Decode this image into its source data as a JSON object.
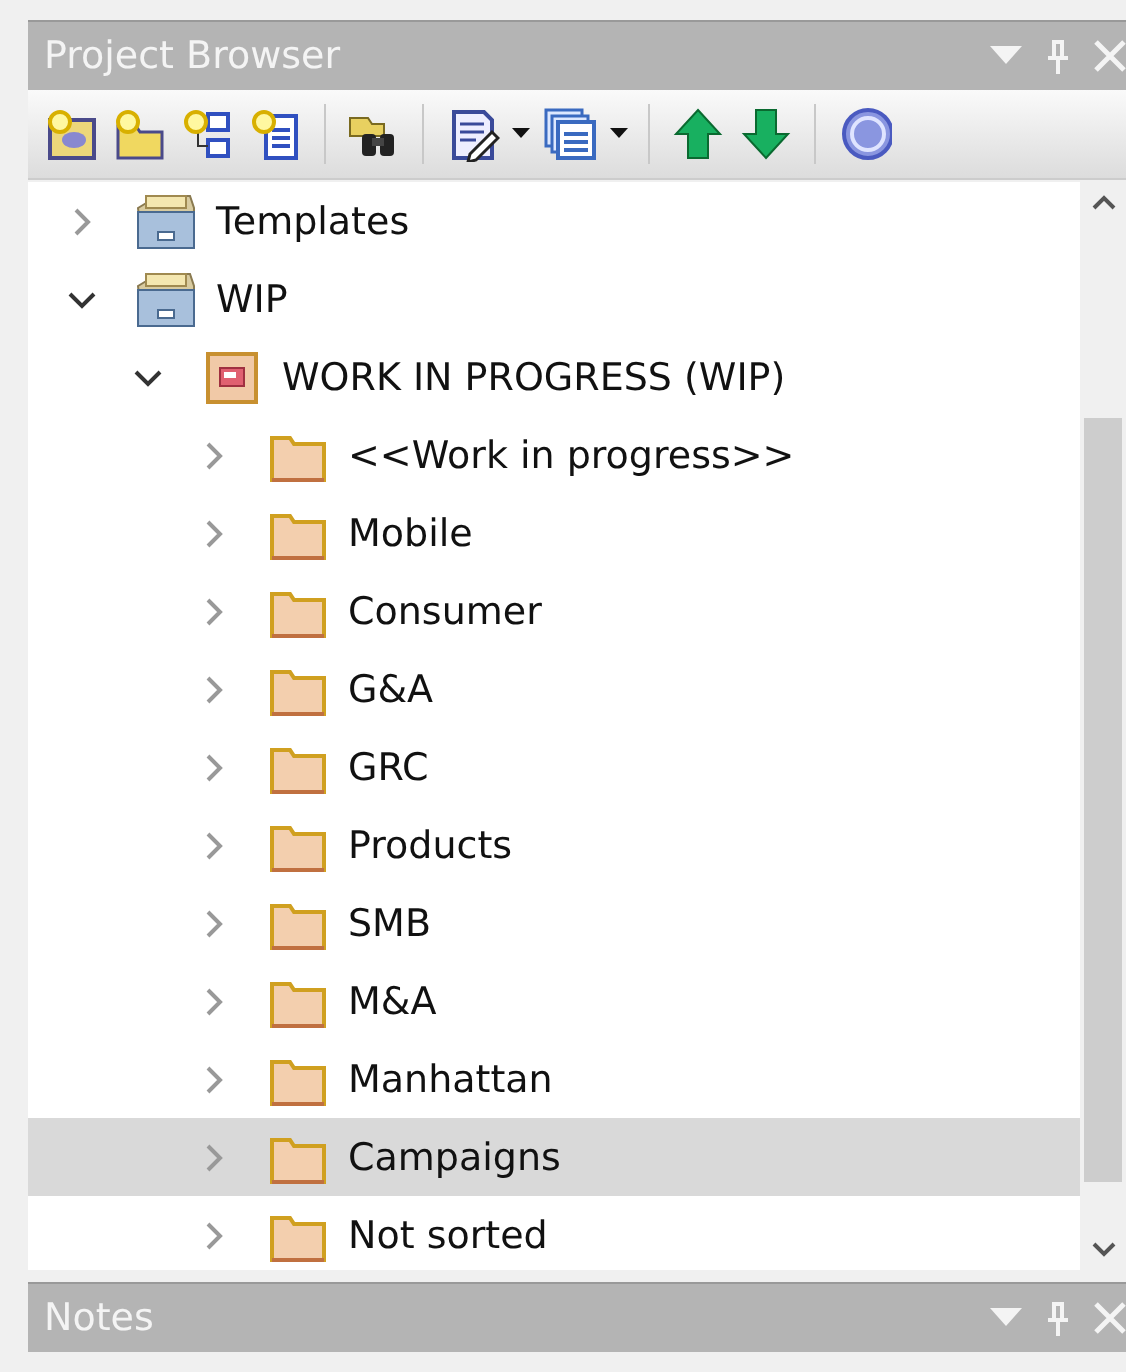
{
  "project_browser": {
    "title": "Project Browser",
    "tree": [
      {
        "label": "Templates",
        "kind": "repository",
        "expanded": false,
        "selected": false
      },
      {
        "label": "WIP",
        "kind": "repository",
        "expanded": true,
        "selected": false,
        "children": [
          {
            "label": "WORK IN PROGRESS (WIP)",
            "kind": "model",
            "expanded": true,
            "selected": false,
            "children": [
              {
                "label": "<<Work in progress>>",
                "kind": "folder",
                "expanded": false,
                "selected": false
              },
              {
                "label": "Mobile",
                "kind": "folder",
                "expanded": false,
                "selected": false
              },
              {
                "label": "Consumer",
                "kind": "folder",
                "expanded": false,
                "selected": false
              },
              {
                "label": "G&A",
                "kind": "folder",
                "expanded": false,
                "selected": false
              },
              {
                "label": "GRC",
                "kind": "folder",
                "expanded": false,
                "selected": false
              },
              {
                "label": "Products",
                "kind": "folder",
                "expanded": false,
                "selected": false
              },
              {
                "label": "SMB",
                "kind": "folder",
                "expanded": false,
                "selected": false
              },
              {
                "label": "M&A",
                "kind": "folder",
                "expanded": false,
                "selected": false
              },
              {
                "label": "Manhattan",
                "kind": "folder",
                "expanded": false,
                "selected": false
              },
              {
                "label": "Campaigns",
                "kind": "folder",
                "expanded": false,
                "selected": true
              },
              {
                "label": "Not sorted",
                "kind": "folder",
                "expanded": false,
                "selected": false
              }
            ]
          }
        ]
      }
    ]
  },
  "notes": {
    "title": "Notes"
  }
}
